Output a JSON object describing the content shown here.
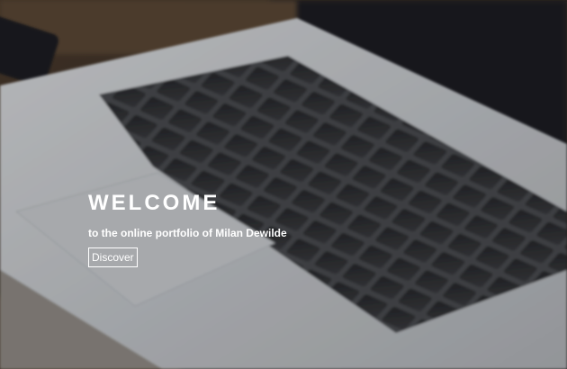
{
  "hero": {
    "title": "WELCOME",
    "subtitle": "to the online portfolio of Milan Dewilde",
    "discover_label": "Discover"
  },
  "colors": {
    "text": "#ffffff",
    "background_dark": "#2b2b2b",
    "laptop_body": "#c9ccd0",
    "keys": "#2e2f33"
  },
  "background_image": "blurred-laptop-keyboard-photo"
}
